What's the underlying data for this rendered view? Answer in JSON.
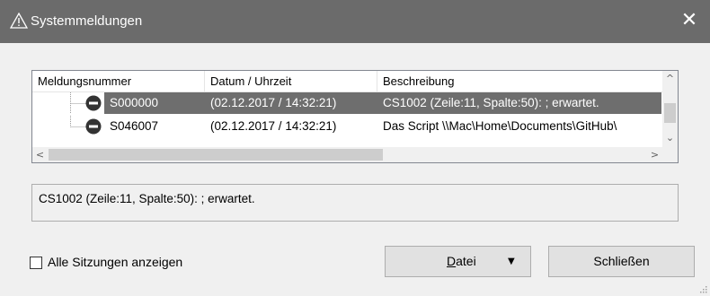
{
  "window": {
    "title": "Systemmeldungen",
    "title_icon": "warning-triangle-icon",
    "close_glyph": "✕",
    "titlebar_color": "#6b6b6b"
  },
  "list": {
    "columns": [
      "Meldungsnummer",
      "Datum / Uhrzeit",
      "Beschreibung"
    ],
    "rows": [
      {
        "id": "S000000",
        "datetime": "(02.12.2017 / 14:32:21)",
        "description": "CS1002 (Zeile:11, Spalte:50): ; erwartet.",
        "icon": "error-icon",
        "selected": true
      },
      {
        "id": "S046007",
        "datetime": "(02.12.2017 / 14:32:21)",
        "description": "Das Script \\\\Mac\\Home\\Documents\\GitHub\\",
        "icon": "error-icon",
        "selected": false
      }
    ],
    "selection_color": "#6e6e6e",
    "scroll": {
      "up": "^",
      "down": "⌄",
      "left": "<",
      "right": ">"
    }
  },
  "detail": {
    "text": "CS1002 (Zeile:11, Spalte:50): ; erwartet."
  },
  "footer": {
    "show_all_sessions_label": "Alle Sitzungen anzeigen",
    "show_all_sessions_checked": false,
    "file_button_label_mnemonic": "D",
    "file_button_label_rest": "atei",
    "file_button_caret": "▼",
    "close_button_label": "Schließen"
  }
}
